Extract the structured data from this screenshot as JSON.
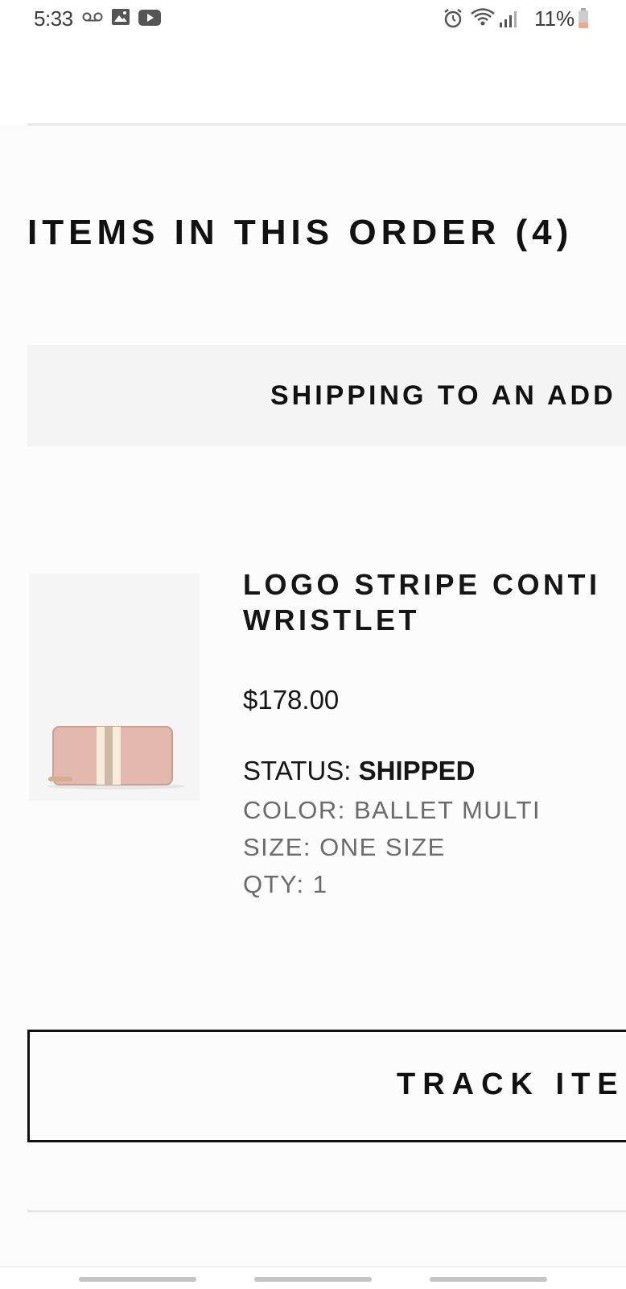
{
  "status_bar": {
    "time": "5:33",
    "battery_text": "11%",
    "icons": [
      "voicemail-icon",
      "image-icon",
      "youtube-icon",
      "alarm-icon",
      "wifi-icon",
      "signal-icon",
      "battery-icon"
    ]
  },
  "order": {
    "section_title": "ITEMS IN THIS ORDER (4)",
    "shipping_label": "SHIPPING TO AN ADD"
  },
  "item": {
    "name_line1": "LOGO STRIPE CONTI",
    "name_line2": "WRISTLET",
    "price": "$178.00",
    "status_label": "STATUS:",
    "status_value": "SHIPPED",
    "color": "COLOR: BALLET MULTI",
    "size": "SIZE: ONE SIZE",
    "qty": "QTY: 1"
  },
  "actions": {
    "track_label": "TRACK ITEM"
  },
  "colors": {
    "accent_text": "#111111",
    "muted_text": "#6b6b6b",
    "product_pink": "#e3b8ae"
  }
}
